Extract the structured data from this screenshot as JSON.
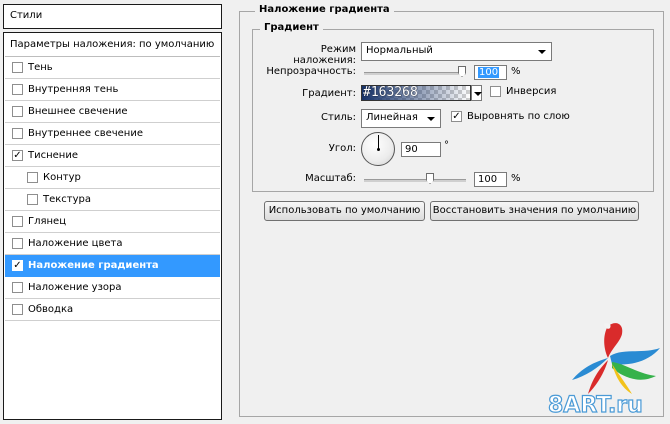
{
  "left_panel": {
    "header": "Стили",
    "items": [
      {
        "label": "Параметры наложения: по умолчанию",
        "kind": "defaults"
      },
      {
        "label": "Тень",
        "checked": false
      },
      {
        "label": "Внутренняя тень",
        "checked": false
      },
      {
        "label": "Внешнее свечение",
        "checked": false
      },
      {
        "label": "Внутреннее свечение",
        "checked": false
      },
      {
        "label": "Тиснение",
        "checked": true
      },
      {
        "label": "Контур",
        "checked": false,
        "sub": true
      },
      {
        "label": "Текстура",
        "checked": false,
        "sub": true
      },
      {
        "label": "Глянец",
        "checked": false
      },
      {
        "label": "Наложение цвета",
        "checked": false
      },
      {
        "label": "Наложение градиента",
        "checked": true,
        "selected": true
      },
      {
        "label": "Наложение узора",
        "checked": false
      },
      {
        "label": "Обводка",
        "checked": false
      }
    ]
  },
  "panel": {
    "title": "Наложение градиента",
    "group_title": "Градиент",
    "blend_mode": {
      "label": "Режим наложения:",
      "value": "Нормальный"
    },
    "opacity": {
      "label": "Непрозрачность:",
      "value": "100",
      "unit": "%",
      "level": 1.0
    },
    "gradient": {
      "label": "Градиент:",
      "value": "#163268",
      "color": "#163268",
      "reverse_label": "Инверсия",
      "reverse_checked": false
    },
    "style": {
      "label": "Стиль:",
      "value": "Линейная",
      "align_label": "Выровнять по слою",
      "align_checked": true
    },
    "angle": {
      "label": "Угол:",
      "value": "90",
      "unit": "°"
    },
    "scale": {
      "label": "Масштаб:",
      "value": "100",
      "unit": "%",
      "level": 0.66
    },
    "buttons": {
      "make_default": "Использовать по умолчанию",
      "reset_default": "Восстановить значения по умолчанию"
    }
  },
  "watermark": {
    "text": "8ART.ru"
  },
  "colors": {
    "selection": "#3399ff",
    "gradient": "#163268"
  }
}
